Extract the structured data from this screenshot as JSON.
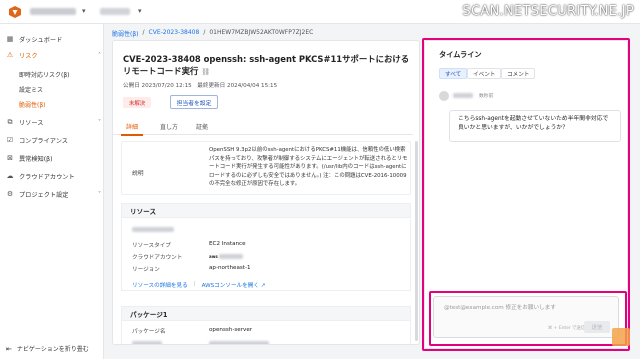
{
  "header": {
    "watermark": "SCAN.NETSECURITY.NE.JP"
  },
  "sidebar": {
    "items": [
      {
        "label": "ダッシュボード",
        "icon": "dashboard-icon"
      },
      {
        "label": "リスク",
        "icon": "risk-icon"
      },
      {
        "label": "リソース",
        "icon": "resource-icon"
      },
      {
        "label": "コンプライアンス",
        "icon": "compliance-icon"
      },
      {
        "label": "異常検知(β)",
        "icon": "anomaly-icon"
      },
      {
        "label": "クラウドアカウント",
        "icon": "cloud-icon"
      },
      {
        "label": "プロジェクト設定",
        "icon": "gear-icon"
      }
    ],
    "risk_sub": [
      {
        "label": "即時対応リスク(β)"
      },
      {
        "label": "設定ミス"
      },
      {
        "label": "脆弱性(β)"
      }
    ],
    "collapse_label": "ナビゲーションを折り畳む"
  },
  "breadcrumb": {
    "root": "脆弱性(β)",
    "cve": "CVE-2023-38408",
    "id": "01HEW7MZBJW52AKT0WFP7ZJ2EC"
  },
  "issue": {
    "title": "CVE-2023-38408 openssh: ssh-agent PKCS#11サポートにおけるリモートコード実行",
    "meta": "公開日 2023/07/20 12:15　最終更新日 2024/04/04 15:15",
    "status": "未解決",
    "assignee_button": "担当者を設定",
    "tabs": [
      "詳細",
      "直し方",
      "証拠"
    ],
    "description_label": "説明",
    "description": "OpenSSH 9.3p2以前のssh-agentにおけるPKCS#11機能は、信頼性の低い検索パスを持っており、攻撃者が制御するシステムにエージェントが転送されるとリモートコード実行が発生する可能性があります。(/usr/lib内のコードはssh-agentにロードするのに必ずしも安全ではありません。) 注：この問題はCVE-2016-10009の不完全な修正が原因で存在します。"
  },
  "resource": {
    "section_title": "リソース",
    "rows": [
      {
        "key": "リソースタイプ",
        "value": "EC2 Instance"
      },
      {
        "key": "クラウドアカウント",
        "value": ""
      },
      {
        "key": "リージョン",
        "value": "ap-northeast-1"
      }
    ],
    "detail_link": "リソースの詳細を見る",
    "console_link": "AWSコンソールを開く ↗",
    "aws_badge": "aws"
  },
  "package": {
    "section_title": "パッケージ1",
    "name_key": "パッケージ名",
    "name_value": "openssh-server"
  },
  "timeline": {
    "title": "タイムライン",
    "filters": [
      "すべて",
      "イベント",
      "コメント"
    ],
    "entry_time": "数秒前",
    "comment": "こちらssh-agentを起動させていないため半年間非対応で良いかと思いますが、いかがでしょうか？",
    "input_placeholder": "@test@example.com 修正をお願いします",
    "send_hint": "⌘ + Enter で送信",
    "send_label": "送信"
  }
}
